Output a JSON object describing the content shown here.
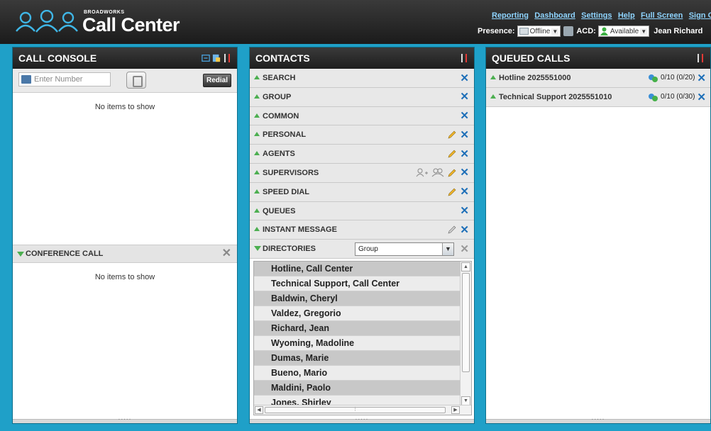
{
  "header": {
    "brand_small": "BROADWORKS",
    "brand_title": "Call Center",
    "nav_links": [
      "Reporting",
      "Dashboard",
      "Settings",
      "Help",
      "Full Screen",
      "Sign Ou"
    ],
    "presence_label": "Presence:",
    "presence_value": "Offline",
    "acd_label": "ACD:",
    "acd_value": "Available",
    "user_name": "Jean Richard"
  },
  "call_console": {
    "title": "CALL CONSOLE",
    "number_placeholder": "Enter Number",
    "redial_label": "Redial",
    "calls_empty": "No items to show",
    "conference_title": "CONFERENCE CALL",
    "conference_empty": "No items to show"
  },
  "contacts": {
    "title": "CONTACTS",
    "sections": [
      "SEARCH",
      "GROUP",
      "COMMON",
      "PERSONAL",
      "AGENTS",
      "SUPERVISORS",
      "SPEED DIAL",
      "QUEUES",
      "INSTANT MESSAGE"
    ],
    "directories_label": "DIRECTORIES",
    "directory_filter": "Group",
    "directory_entries": [
      "Hotline, Call Center",
      "Technical Support, Call Center",
      "Baldwin, Cheryl",
      "Valdez, Gregorio",
      "Richard, Jean",
      "Wyoming, Madoline",
      "Dumas, Marie",
      "Bueno, Mario",
      "Maldini, Paolo",
      "Jones, Shirley"
    ]
  },
  "queued_calls": {
    "title": "QUEUED CALLS",
    "queues": [
      {
        "name": "Hotline 2025551000",
        "stats": "0/10 (0/20)"
      },
      {
        "name": "Technical Support 2025551010",
        "stats": "0/10 (0/30)"
      }
    ]
  },
  "colors": {
    "background": "#1fa0c8",
    "header": "#1b1b1b",
    "link": "#8fd4ff",
    "close_blue": "#1d6fb8",
    "expand_green": "#4caf50"
  }
}
